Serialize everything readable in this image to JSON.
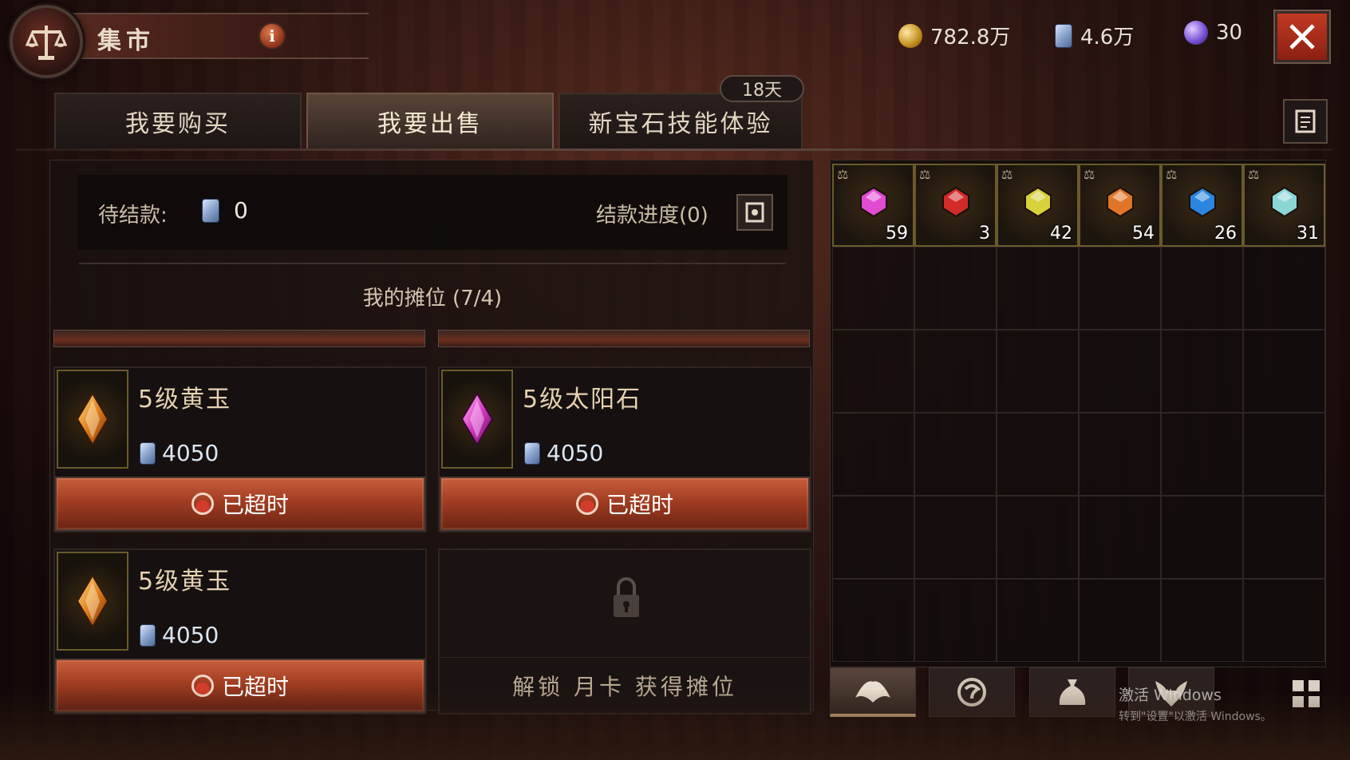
{
  "header": {
    "title": "集市",
    "info_label": "i",
    "logo_icon": "scales-icon",
    "close_icon": "close-icon"
  },
  "currencies": [
    {
      "icon": "gold-coin-icon",
      "value": "782.8万"
    },
    {
      "icon": "silver-ticket-icon",
      "value": "4.6万"
    },
    {
      "icon": "purple-orb-icon",
      "value": "30"
    }
  ],
  "tabs": [
    {
      "label": "我要购买",
      "active": false
    },
    {
      "label": "我要出售",
      "active": true
    },
    {
      "label": "新宝石技能体验",
      "active": false
    }
  ],
  "day_badge": "18天",
  "left_panel": {
    "pending_label": "待结款:",
    "pending_value": "0",
    "progress_label": "结款进度(0)",
    "stall_title": "我的摊位 (7/4)",
    "slots": [
      {
        "name": "5级黄玉",
        "gem": "topaz",
        "price": "4050",
        "status": "已超时"
      },
      {
        "name": "5级太阳石",
        "gem": "sunstone",
        "price": "4050",
        "status": "已超时"
      },
      {
        "name": "5级黄玉",
        "gem": "topaz",
        "price": "4050",
        "status": "已超时"
      }
    ],
    "locked_slot_text": "解锁 月卡 获得摊位"
  },
  "inventory": {
    "items": [
      {
        "gem": "pink",
        "color": "#e04bd2",
        "qty": "59"
      },
      {
        "gem": "red",
        "color": "#d32a2a",
        "qty": "3"
      },
      {
        "gem": "yellow",
        "color": "#d8d23a",
        "qty": "42"
      },
      {
        "gem": "orange",
        "color": "#e0752a",
        "qty": "54"
      },
      {
        "gem": "blue",
        "color": "#2a86e0",
        "qty": "26"
      },
      {
        "gem": "cyan",
        "color": "#8ad6d6",
        "qty": "31"
      }
    ]
  },
  "bottom_bar": {
    "tabs": [
      "gem-category-icon",
      "rune-category-icon",
      "bag-category-icon",
      "demon-category-icon"
    ]
  },
  "watermark": {
    "line1": "激活 Windows",
    "line2": "转到\"设置\"以激活 Windows。"
  },
  "colors": {
    "accent_red": "#a13d22",
    "gold_border": "#6a5a2a",
    "background": "#140a08"
  }
}
